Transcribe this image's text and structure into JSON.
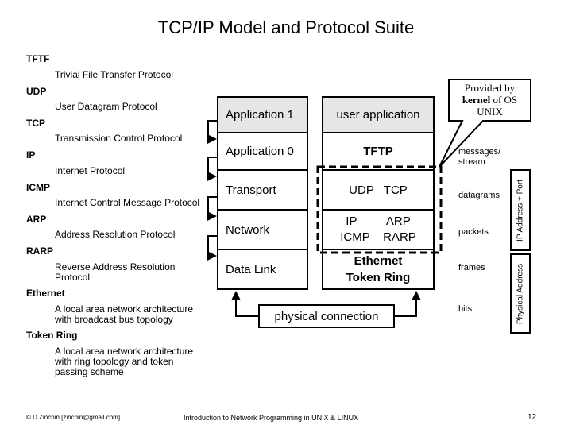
{
  "title": "TCP/IP Model and Protocol Suite",
  "glossary": [
    {
      "term": "TFTF",
      "desc": "Trivial File Transfer Protocol"
    },
    {
      "term": "UDP",
      "desc": "User Datagram Protocol"
    },
    {
      "term": "TCP",
      "desc": "Transmission Control Protocol"
    },
    {
      "term": "IP",
      "desc": "Internet Protocol"
    },
    {
      "term": "ICMP",
      "desc": "Internet Control Message Protocol"
    },
    {
      "term": "ARP",
      "desc": "Address Resolution Protocol"
    },
    {
      "term": "RARP",
      "desc": "Reverse Address Resolution Protocol"
    },
    {
      "term": "Ethernet",
      "desc": "A local area network architecture with broadcast bus topology"
    },
    {
      "term": "Token Ring",
      "desc": "A local area network architecture with ring topology and token passing scheme"
    }
  ],
  "osi_layers": [
    "Application 1",
    "Application 0",
    "Transport",
    "Network",
    "Data Link"
  ],
  "protocol_layers": [
    {
      "line1": "user application",
      "line2": ""
    },
    {
      "line1": "TFTP",
      "line2": ""
    },
    {
      "line1": "UDP   TCP",
      "line2": ""
    },
    {
      "line1": "IP         ARP",
      "line2": "ICMP    RARP"
    },
    {
      "line1": "Ethernet",
      "line2": "Token Ring"
    }
  ],
  "callout": {
    "line1": "Provided by",
    "bold": "kernel",
    "line2_rest": " of OS",
    "line3": "UNIX"
  },
  "physical_connection": "physical connection",
  "data_units": [
    "messages/",
    "stream",
    "datagrams",
    "packets",
    "frames",
    "bits"
  ],
  "address_boxes": {
    "upper": "IP Address + Port",
    "lower": "Physical Address"
  },
  "footer": {
    "left": "© D Zinchin [zinchin@gmail.com]",
    "center": "Introduction to Network Programming in UNIX & LINUX",
    "page": "12"
  }
}
